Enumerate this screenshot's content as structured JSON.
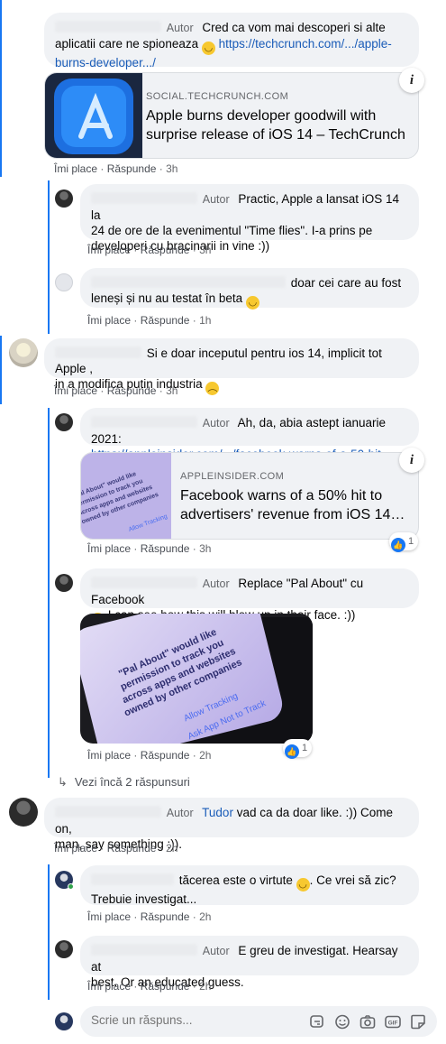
{
  "labels": {
    "author": "Autor",
    "like": "Îmi place",
    "reply": "Răspunde",
    "sep": "·"
  },
  "comments": [
    {
      "text": "Cred ca vom mai descoperi si alte aplicatii care ne spioneaza",
      "link": "https://techcrunch.com/.../apple-burns-developer.../",
      "time": "3h"
    },
    {
      "text1": "Practic, Apple a lansat iOS 14 la",
      "text2": "24 de ore de la evenimentul \"Time flies\". I-a prins pe",
      "text3": "developeri cu bracinarii in vine :))",
      "time": "3h"
    },
    {
      "text1": "doar cei care au fost",
      "text2": "leneși și nu au testat în beta",
      "time": "1h"
    },
    {
      "text1": "Si e doar inceputul pentru ios 14, implicit tot Apple ,",
      "text2": "in a modifica putin industria",
      "time": "3h"
    },
    {
      "text1": "Ah, da, abia astept ianuarie 2021:",
      "link": "https://appleinsider.com/.../facebook-warns-of-a-50-hit...",
      "time": "3h",
      "reactions": "1"
    },
    {
      "text1": "Replace \"Pal About\" cu Facebook",
      "text2": "I can see how this will blow up in their face. :))",
      "time": "2h",
      "reactions": "1"
    },
    {
      "mention": "Tudor",
      "text1": "vad ca da doar like. :)) Come on,",
      "text2": "man, say something :)).",
      "time": "2h"
    },
    {
      "text1": "tăcerea este o virtute",
      "text1b": ". Ce vrei să zic?",
      "text2": "Trebuie investigat...",
      "time": "2h"
    },
    {
      "text1": "E greu de investigat. Hearsay at",
      "text2": "best. Or an educated guess.",
      "time": "2h"
    }
  ],
  "cards": [
    {
      "domain": "SOCIAL.TECHCRUNCH.COM",
      "title1": "Apple burns developer goodwill with",
      "title2": "surprise release of iOS 14 – TechCrunch",
      "info": "i"
    },
    {
      "domain": "APPLEINSIDER.COM",
      "title1": "Facebook warns of a 50% hit to",
      "title2": "advertisers' revenue from iOS 14…",
      "info": "i"
    }
  ],
  "thumb_texts": [
    "\"Pal About\" would like",
    "permission to track you",
    "across apps and websites",
    "owned by other companies",
    "Allow Tracking",
    "Ask App Not to Track"
  ],
  "more_replies": "Vezi încă 2 răspunsuri",
  "reply_placeholder": "Scrie un răspuns...",
  "icons": [
    "arrow-reply-icon",
    "sticker-icon",
    "emoji-icon",
    "camera-icon",
    "gif-icon",
    "smile-sticker-icon"
  ],
  "colors": {
    "thread_line": "#1877f2",
    "bubble": "#f0f2f5",
    "link": "#1a5cb8",
    "meta": "#65676b"
  }
}
